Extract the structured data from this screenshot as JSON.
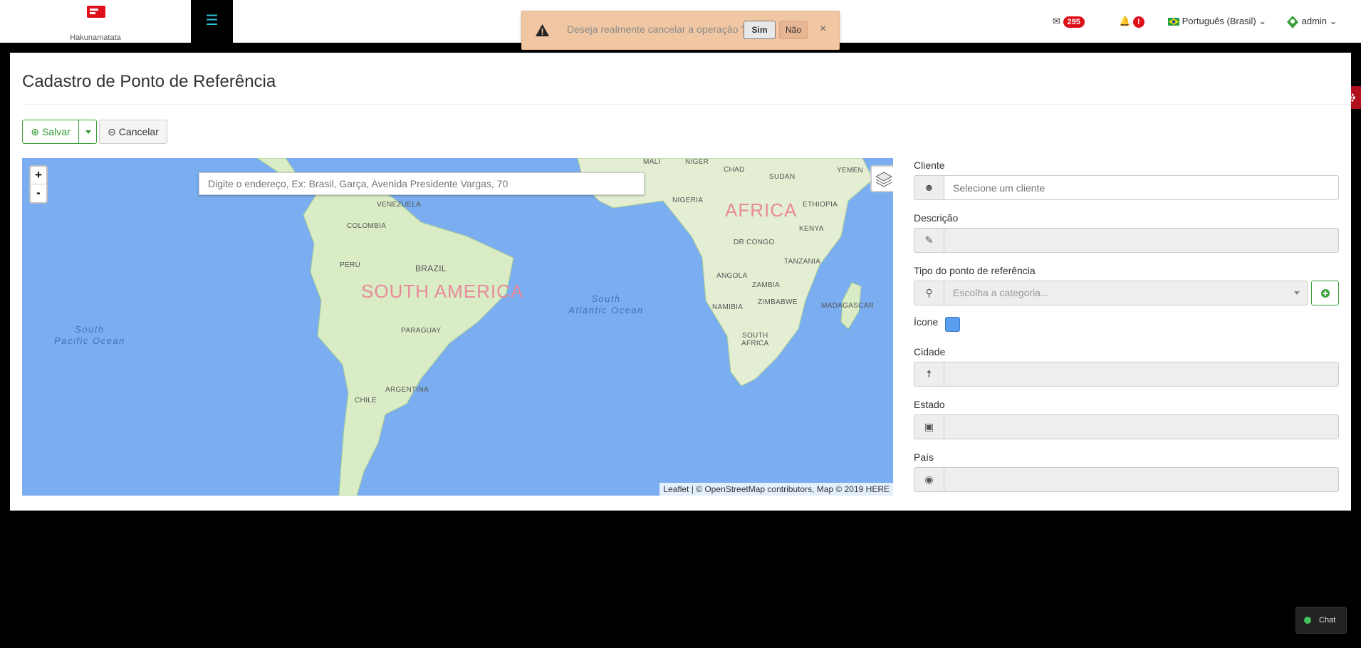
{
  "brand": {
    "name": "Hakunamatata"
  },
  "topbar": {
    "mail_count": "295",
    "alert_count": "!",
    "language": "Português (Brasil)",
    "user": "admin"
  },
  "toast": {
    "message": "Deseja realmente cancelar a operação ?",
    "yes_label": "Sim",
    "no_label": "Não",
    "close_label": "×"
  },
  "page": {
    "title": "Cadastro de Ponto de Referência"
  },
  "toolbar": {
    "save_label": "Salvar",
    "cancel_label": "Cancelar"
  },
  "map": {
    "search_placeholder": "Digite o endereço, Ex: Brasil, Garça, Avenida Presidente Vargas, 70",
    "zoom_in": "+",
    "zoom_out": "-",
    "attribution_leaflet": "Leaflet",
    "attribution_rest": " | © OpenStreetMap contributors, Map © 2019 HERE",
    "labels": {
      "south_america": "SOUTH AMERICA",
      "africa": "AFRICA",
      "south_atlantic_1": "South",
      "south_atlantic_2": "Atlantic Ocean",
      "south_pacific_1": "South",
      "south_pacific_2": "Pacific Ocean",
      "venezuela": "VENEZUELA",
      "colombia": "COLOMBIA",
      "peru": "PERU",
      "brazil": "BRAZIL",
      "paraguay": "PARAGUAY",
      "argentina": "ARGENTINA",
      "chile": "CHILE",
      "mali": "MALI",
      "niger": "NIGER",
      "chad": "CHAD",
      "sudan": "SUDAN",
      "yemen": "YEMEN",
      "nigeria": "NIGERIA",
      "ethiopia": "ETHIOPIA",
      "kenya": "KENYA",
      "dr_congo": "DR CONGO",
      "tanzania": "TANZANIA",
      "angola": "ANGOLA",
      "zambia": "ZAMBIA",
      "namibia": "NAMIBIA",
      "zimbabwe": "ZIMBABWE",
      "madagascar": "MADAGASCAR",
      "south_africa_1": "SOUTH",
      "south_africa_2": "AFRICA"
    }
  },
  "form": {
    "cliente": {
      "label": "Cliente",
      "placeholder": "Selecione um cliente"
    },
    "descricao": {
      "label": "Descrição"
    },
    "tipo": {
      "label": "Tipo do ponto de referência",
      "placeholder": "Escolha a categoria..."
    },
    "icone": {
      "label": "Ícone",
      "color": "#5a9ef0"
    },
    "cidade": {
      "label": "Cidade"
    },
    "estado": {
      "label": "Estado"
    },
    "pais": {
      "label": "País"
    }
  },
  "chat": {
    "label": "Chat"
  },
  "colors": {
    "accent_green": "#3aa13a",
    "badge_red": "#e0101a",
    "toast_bg": "#f1c7a3"
  }
}
